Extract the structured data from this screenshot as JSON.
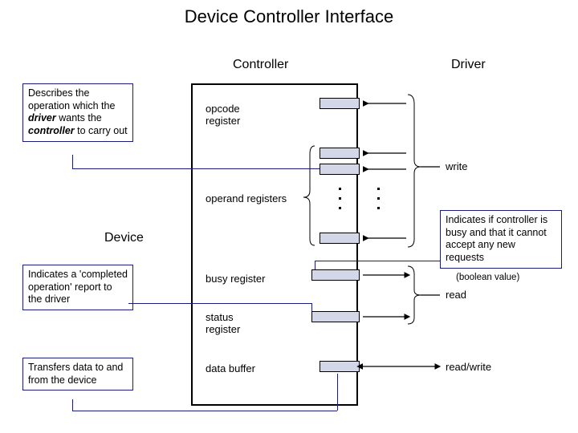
{
  "title": "Device Controller Interface",
  "headings": {
    "controller": "Controller",
    "driver": "Driver",
    "device": "Device"
  },
  "registers": {
    "opcode": "opcode\nregister",
    "operand": "operand registers",
    "busy": "busy register",
    "status": "status\nregister",
    "data_buffer": "data buffer"
  },
  "rw": {
    "write": "write",
    "read": "read",
    "readwrite": "read/write"
  },
  "notes": {
    "opcode": "Describes the operation which the driver wants the controller to carry out",
    "busy": "Indicates if controller is busy and that it cannot accept any new requests",
    "busy_type": "(boolean value)",
    "status": "Indicates a 'completed operation' report to the driver",
    "data_buffer": "Transfers data to and from the device"
  },
  "emph": {
    "driver": "driver",
    "controller": "controller"
  }
}
